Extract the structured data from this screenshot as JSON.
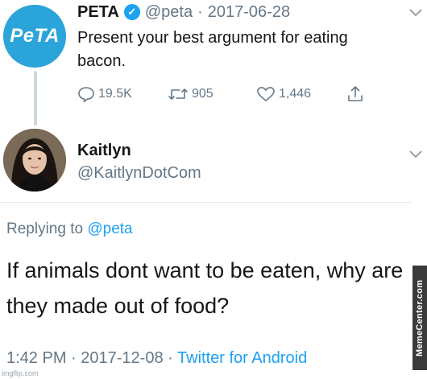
{
  "tweet1": {
    "avatar_text": "PeTA",
    "author_name": "PETA",
    "verified_mark": "✓",
    "handle": "@peta",
    "separator": "·",
    "date": "2017-06-28",
    "text": "Present your best argument for eating bacon.",
    "actions": {
      "replies": "19.5K",
      "retweets": "905",
      "likes": "1,446"
    }
  },
  "tweet2": {
    "author_name": "Kaitlyn",
    "handle": "@KaitlynDotCom",
    "replying_prefix": "Replying to",
    "replying_to": "@peta",
    "text": "If animals dont want to be eaten, why are they made out of food?",
    "time": "1:42 PM",
    "date": "2017-12-08",
    "separator": "·",
    "source": "Twitter for Android"
  },
  "watermarks": {
    "side": "MemeCenter.com",
    "bottom": "imgflip.com"
  },
  "colors": {
    "accent": "#1da1f2",
    "peta_blue": "#2aa4d9",
    "muted": "#657786"
  }
}
